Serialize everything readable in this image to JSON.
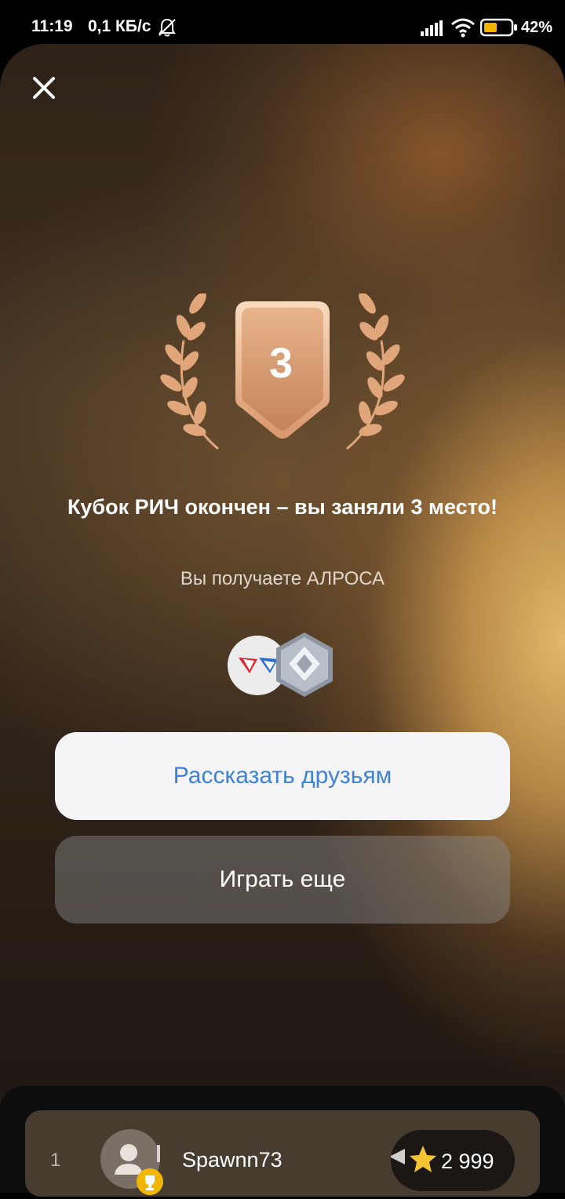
{
  "status_bar": {
    "time": "11:19",
    "speed": "0,1 КБ/с",
    "battery": "42%",
    "icons": [
      "bell-off-icon",
      "signal-icon",
      "wifi-icon",
      "battery-icon"
    ]
  },
  "result": {
    "place": "3",
    "title": "Кубок РИЧ окончен – вы заняли 3 место!",
    "subtitle": "Вы получаете АЛРОСА"
  },
  "buttons": {
    "share": "Рассказать друзьям",
    "play_again": "Играть еще"
  },
  "leaderboard": {
    "rank": "1",
    "username": "Spawnn73",
    "score": "2 999"
  },
  "colors": {
    "accent_blue": "#3d82d8",
    "bronze": "#d99b6c",
    "star": "#f4c430"
  }
}
